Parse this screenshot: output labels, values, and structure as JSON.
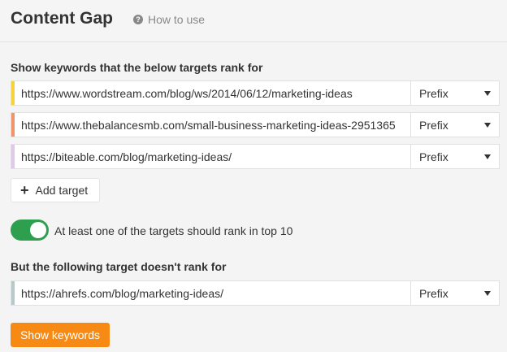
{
  "header": {
    "title": "Content Gap",
    "help_label": "How to use",
    "help_icon": "question-circle-icon"
  },
  "targets_section": {
    "label": "Show keywords that the below targets rank for",
    "targets": [
      {
        "url": "https://www.wordstream.com/blog/ws/2014/06/12/marketing-ideas",
        "mode": "Prefix",
        "color": "#f5d33b"
      },
      {
        "url": "https://www.thebalancesmb.com/small-business-marketing-ideas-2951365",
        "mode": "Prefix",
        "color": "#f0956b"
      },
      {
        "url": "https://biteable.com/blog/marketing-ideas/",
        "mode": "Prefix",
        "color": "#e0c8ea"
      }
    ],
    "add_label": "Add target"
  },
  "toggle": {
    "on": true,
    "label": "At least one of the targets should rank in top 10",
    "color": "#2e9e4f"
  },
  "exclude_section": {
    "label": "But the following target doesn't rank for",
    "target": {
      "url": "https://ahrefs.com/blog/marketing-ideas/",
      "mode": "Prefix",
      "color": "#b8c8cc"
    }
  },
  "submit": {
    "label": "Show keywords",
    "color": "#f68a14"
  }
}
